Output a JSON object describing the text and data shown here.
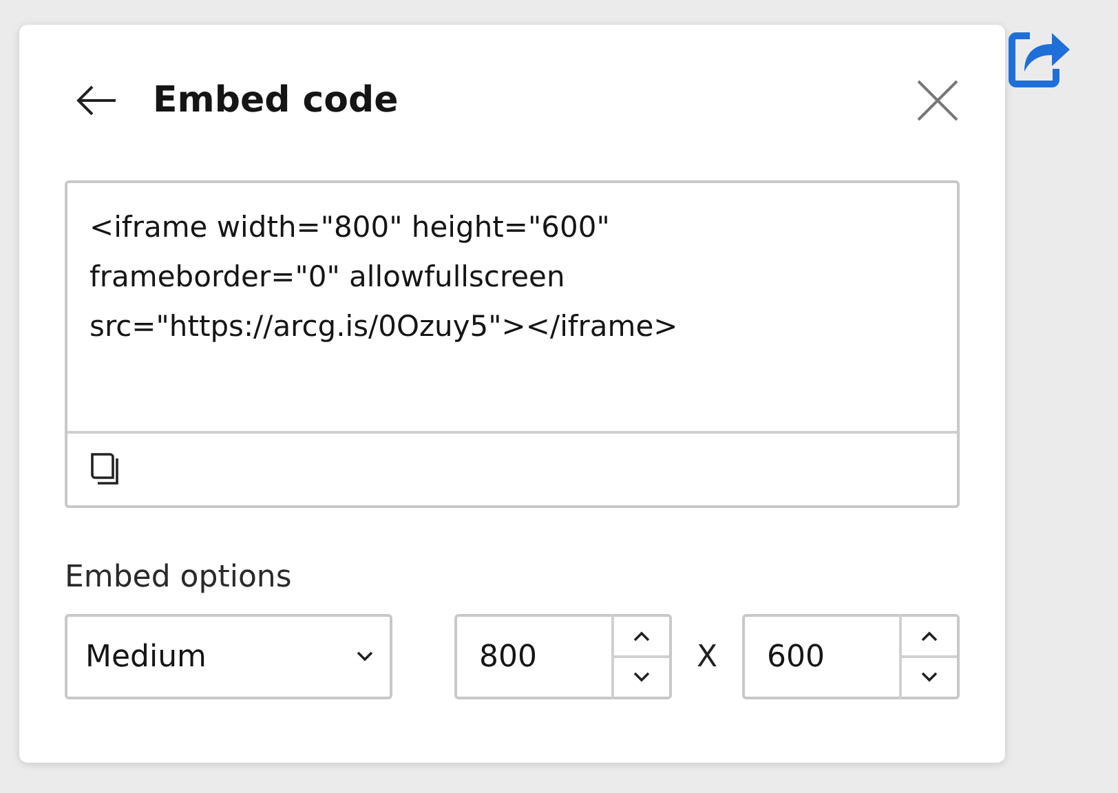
{
  "panel": {
    "title": "Embed code",
    "code": "<iframe width=\"800\" height=\"600\" frameborder=\"0\" allowfullscreen src=\"https://arcg.is/0Ozuy5\"></iframe>",
    "options_label": "Embed options",
    "size_select": {
      "value": "Medium"
    },
    "width_field": {
      "value": "800"
    },
    "separator": "X",
    "height_field": {
      "value": "600"
    }
  }
}
